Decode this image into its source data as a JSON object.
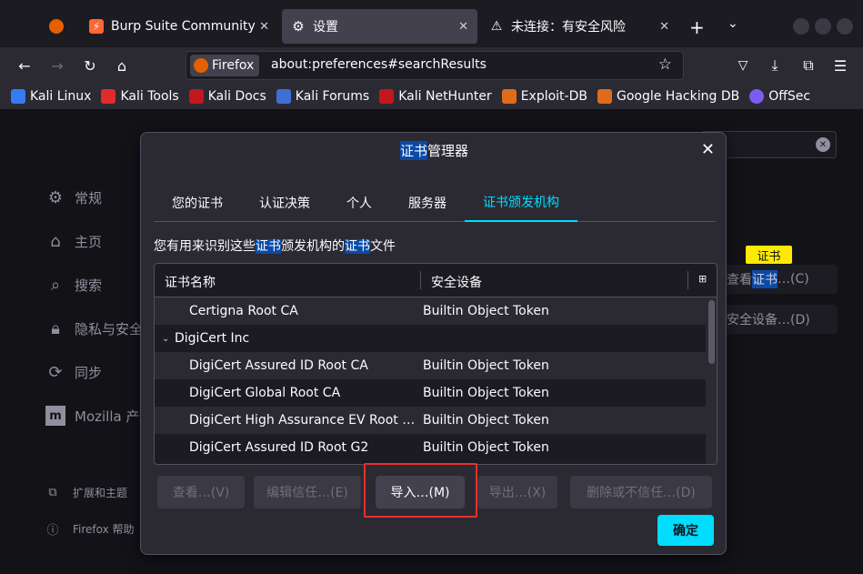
{
  "tabs": [
    {
      "label": "",
      "icon": "firefox-icon"
    },
    {
      "label": "Burp Suite Community Ed",
      "icon": "burp-icon"
    },
    {
      "label": "设置",
      "icon": "gear-icon"
    },
    {
      "label": "未连接：有安全风险",
      "icon": "warning-icon"
    }
  ],
  "nav": {
    "identity_label": "Firefox",
    "url": "about:preferences#searchResults"
  },
  "bookmarks": [
    {
      "label": "Kali Linux",
      "color": "#367bf0"
    },
    {
      "label": "Kali Tools",
      "color": "#e02b2b"
    },
    {
      "label": "Kali Docs",
      "color": "#c2171d"
    },
    {
      "label": "Kali Forums",
      "color": "#3d6fd6"
    },
    {
      "label": "Kali NetHunter",
      "color": "#c2171d"
    },
    {
      "label": "Exploit-DB",
      "color": "#e06c1b"
    },
    {
      "label": "Google Hacking DB",
      "color": "#e06c1b"
    },
    {
      "label": "OffSec",
      "color": "#7b5cf0"
    }
  ],
  "sidebar": {
    "items": [
      {
        "label": "常规",
        "icon": "gear-icon"
      },
      {
        "label": "主页",
        "icon": "home-icon"
      },
      {
        "label": "搜索",
        "icon": "search-icon"
      },
      {
        "label": "隐私与安全",
        "icon": "lock-icon"
      },
      {
        "label": "同步",
        "icon": "sync-icon"
      },
      {
        "label": "Mozilla 产",
        "icon": "mozilla-icon"
      }
    ],
    "footer": [
      {
        "label": "扩展和主题",
        "icon": "puzzle-icon"
      },
      {
        "label": "Firefox 帮助",
        "icon": "help-icon"
      }
    ]
  },
  "background_buttons": {
    "view_certs_pre": "查看",
    "view_certs_hl": "证书",
    "view_certs_post": "…(C)",
    "security_devices": "安全设备…(D)",
    "tooltip": "证书"
  },
  "dialog": {
    "title_hl": "证书",
    "title_rest": "管理器",
    "tabs": [
      "您的证书",
      "认证决策",
      "个人",
      "服务器",
      "证书颁发机构"
    ],
    "active_tab": "证书颁发机构",
    "desc_pre": "您有用来识别这些",
    "desc_hl1": "证书",
    "desc_mid": "颁发机构的",
    "desc_hl2": "证书",
    "desc_post": "文件",
    "columns": [
      "证书名称",
      "安全设备"
    ],
    "rows": [
      {
        "name": "Certigna Root CA",
        "device": "Builtin Object Token",
        "group": false
      },
      {
        "name": "DigiCert Inc",
        "device": "",
        "group": true
      },
      {
        "name": "DigiCert Assured ID Root CA",
        "device": "Builtin Object Token",
        "group": false
      },
      {
        "name": "DigiCert Global Root CA",
        "device": "Builtin Object Token",
        "group": false
      },
      {
        "name": "DigiCert High Assurance EV Root CA",
        "device": "Builtin Object Token",
        "group": false
      },
      {
        "name": "DigiCert Assured ID Root G2",
        "device": "Builtin Object Token",
        "group": false
      }
    ],
    "buttons": {
      "view": "查看…(V)",
      "edit_trust": "编辑信任…(E)",
      "import": "导入…(M)",
      "export": "导出…(X)",
      "delete": "删除或不信任…(D)",
      "ok": "确定"
    }
  },
  "colors": {
    "accent": "#00ddff",
    "highlight": "#0b4aa6",
    "annotation": "#e8302a"
  }
}
